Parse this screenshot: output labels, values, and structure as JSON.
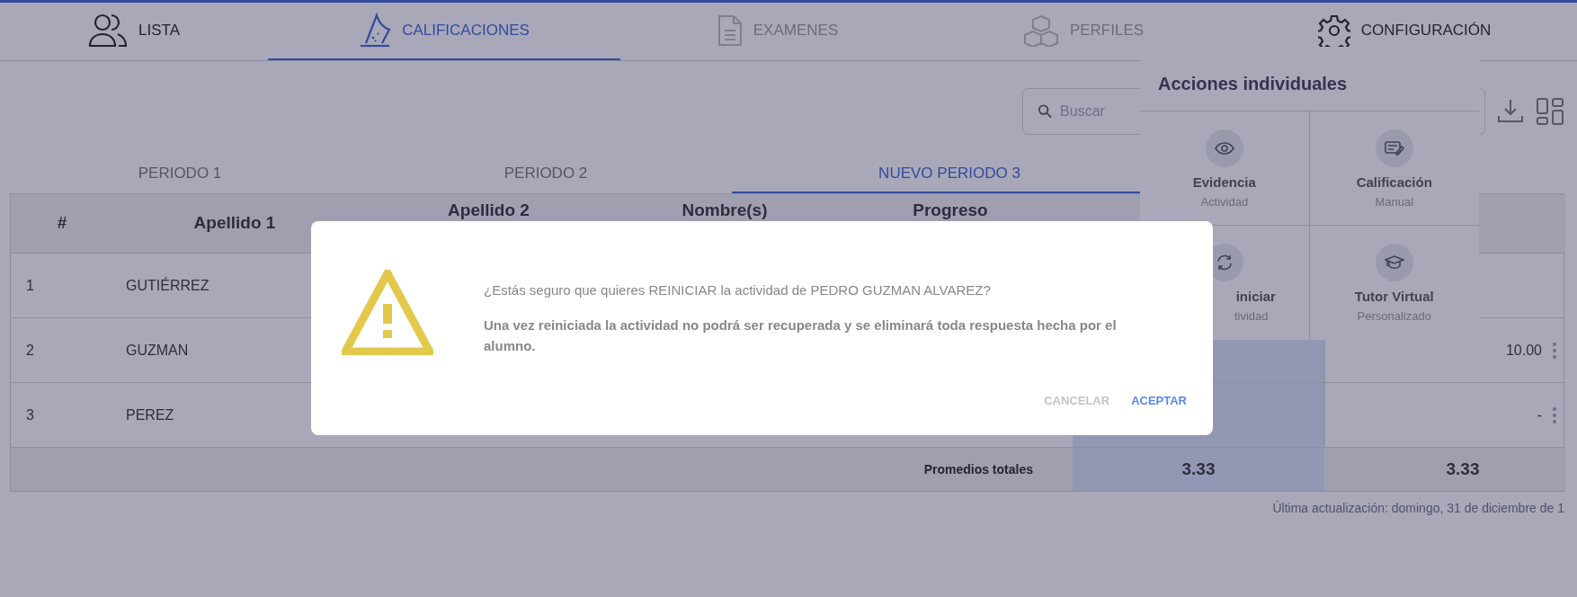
{
  "nav_tabs": [
    {
      "label": "LISTA",
      "selected": false,
      "disabled": false
    },
    {
      "label": "CALIFICACIONES",
      "selected": true,
      "disabled": false
    },
    {
      "label": "EXAMENES",
      "selected": false,
      "disabled": true
    },
    {
      "label": "PERFILES",
      "selected": false,
      "disabled": true
    },
    {
      "label": "CONFIGURACIÓN",
      "selected": false,
      "disabled": false
    }
  ],
  "search": {
    "placeholder": "Buscar"
  },
  "period_tabs": [
    {
      "label": "PERIODO 1",
      "selected": false
    },
    {
      "label": "PERIODO 2",
      "selected": false
    },
    {
      "label": "NUEVO PERIODO 3",
      "selected": true
    }
  ],
  "table": {
    "columns": [
      "#",
      "Apellido 1",
      "Apellido 2",
      "Nombre(s)",
      "Progreso"
    ],
    "rows": [
      {
        "number": "1",
        "apellido_1": "GUTIÉRREZ"
      },
      {
        "number": "2",
        "apellido_1": "GUZMAN",
        "column_7": "10.00"
      },
      {
        "number": "3",
        "apellido_1": "PEREZ",
        "column_7": "-"
      }
    ],
    "totals": {
      "label": "Promedios totales",
      "column_6": "3.33",
      "column_7": "3.33"
    }
  },
  "last_update": "Última actualización: domingo, 31 de diciembre de 1",
  "actions_menu": {
    "title": "Acciones individuales",
    "items": [
      {
        "label": "Evidencia",
        "sublabel": "Actividad"
      },
      {
        "label": "Calificación",
        "sublabel": "Manual"
      },
      {
        "label": "iniciar",
        "sublabel": "tividad"
      },
      {
        "label": "Tutor Virtual",
        "sublabel": "Personalizado"
      }
    ]
  },
  "dialog": {
    "question": "¿Estás seguro que quieres REINICIAR la actividad de PEDRO GUZMAN ALVAREZ?",
    "warning": "Una vez reiniciada la actividad no podrá ser recuperada y se eliminará toda respuesta hecha por el alumno.",
    "buttons": [
      {
        "label": "CANCELAR",
        "kind": "cancel"
      },
      {
        "label": "ACEPTAR",
        "kind": "confirm"
      }
    ]
  }
}
